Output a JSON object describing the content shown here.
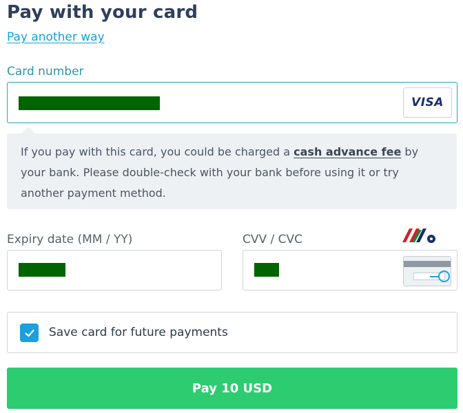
{
  "header": {
    "title": "Pay with your card",
    "alt_payment_link": "Pay another way"
  },
  "card_number": {
    "label": "Card number",
    "value_masked": true,
    "card_brand": "VISA"
  },
  "notice": {
    "text_before": "If you pay with this card, you could be charged a ",
    "link": "cash advance fee",
    "text_after": " by your bank. Please double-check with your bank before using it or try another payment method."
  },
  "expiry": {
    "label": "Expiry date (MM / YY)",
    "value_masked": true
  },
  "cvv": {
    "label": "CVV / CVC",
    "value_masked": true,
    "hint_icon": "card-back-cvv-icon"
  },
  "save_card": {
    "label": "Save card for future payments",
    "checked": true
  },
  "pay_button": {
    "label": "Pay 10 USD"
  },
  "colors": {
    "title": "#2e3f5c",
    "link": "#0ea5d8",
    "label_active": "#2f95a8",
    "focus_border": "#24a6b8",
    "masked_fill": "#006400",
    "notice_bg": "#eef1f4",
    "checkbox": "#1ba0dc",
    "pay_button": "#2ecc71"
  }
}
